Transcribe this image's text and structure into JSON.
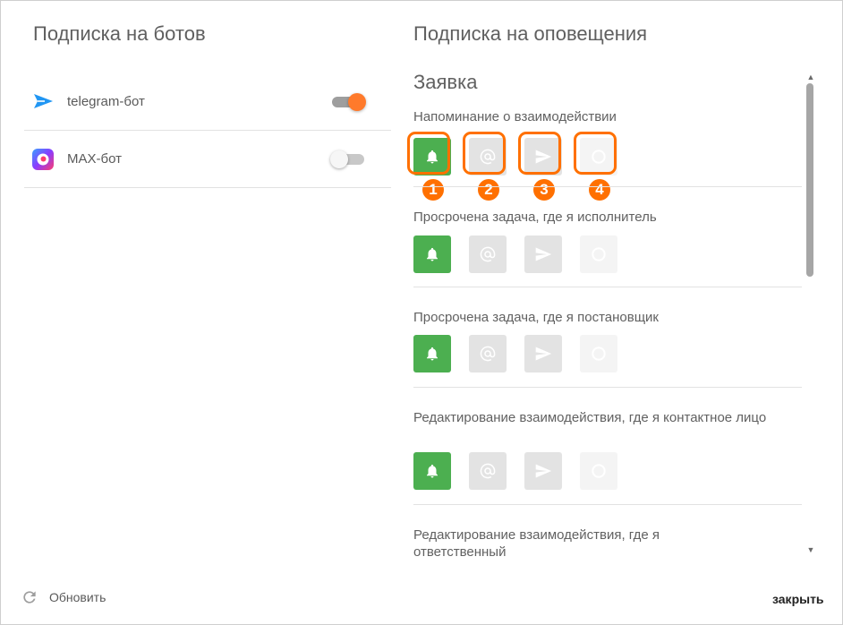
{
  "bots": {
    "title": "Подписка на ботов",
    "items": [
      {
        "label": "telegram-бот",
        "icon": "telegram-icon",
        "enabled": true
      },
      {
        "label": "MAX-бот",
        "icon": "max-logo-icon",
        "enabled": false
      }
    ]
  },
  "notifications": {
    "title": "Подписка на оповещения",
    "section": "Заявка",
    "channels": [
      "bell-icon",
      "at-sign-icon",
      "send-icon",
      "circle-icon"
    ],
    "items": [
      {
        "label": "Напоминание о взаимодействии"
      },
      {
        "label": "Просрочена задача, где я исполнитель"
      },
      {
        "label": "Просрочена задача, где я постановщик"
      },
      {
        "label": "Редактирование взаимодействия, где я контактное лицо"
      },
      {
        "label": "Редактирование взаимодействия, где я ответственный"
      }
    ],
    "badges": [
      "1",
      "2",
      "3",
      "4"
    ]
  },
  "footer": {
    "refresh_label": "Обновить",
    "close_label": "закрыть"
  },
  "colors": {
    "accent": "#ff7000",
    "active": "#4caf50",
    "toggle_on": "#ff7a2b"
  }
}
